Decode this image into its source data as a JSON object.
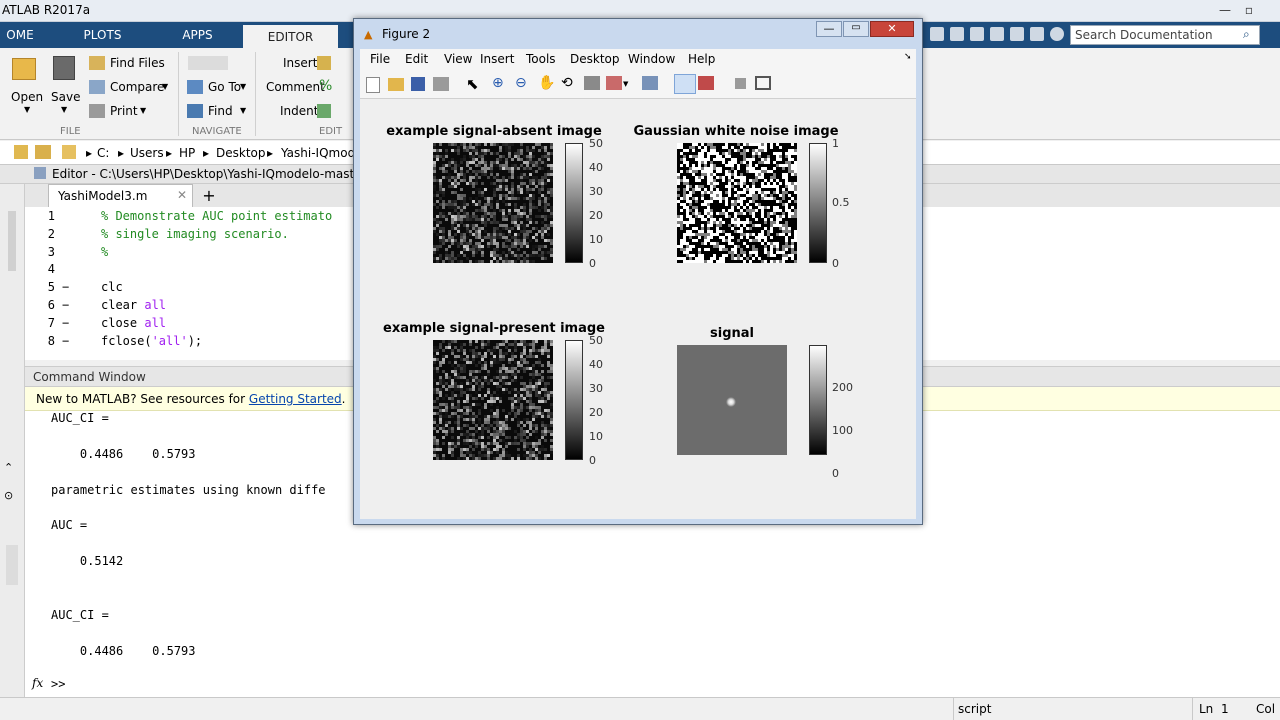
{
  "app": {
    "title": "ATLAB R2017a"
  },
  "tabs": [
    "OME",
    "PLOTS",
    "APPS",
    "EDITOR"
  ],
  "search": {
    "placeholder": "Search Documentation"
  },
  "ribbon": {
    "open": "Open",
    "save": "Save",
    "find_files": "Find Files",
    "compare": "Compare",
    "print": "Print",
    "go_to": "Go To",
    "find": "Find",
    "insert": "Insert",
    "comment": "Comment",
    "indent": "Indent",
    "groups": {
      "file": "FILE",
      "navigate": "NAVIGATE",
      "edit": "EDIT"
    }
  },
  "address": {
    "crumbs": [
      "C:",
      "Users",
      "HP",
      "Desktop",
      "Yashi-IQmode"
    ]
  },
  "editor": {
    "header": "Editor - C:\\Users\\HP\\Desktop\\Yashi-IQmodelo-master\\Ya",
    "tab": "YashiModel3.m",
    "lines": [
      {
        "n": "1",
        "mark": "",
        "text": "% Demonstrate AUC point estimato",
        "kind": "comment"
      },
      {
        "n": "2",
        "mark": "",
        "text": "% single imaging scenario.",
        "kind": "comment"
      },
      {
        "n": "3",
        "mark": "",
        "text": "%",
        "kind": "comment"
      },
      {
        "n": "4",
        "mark": "",
        "text": "",
        "kind": "code"
      },
      {
        "n": "5",
        "mark": "−",
        "text": "clc",
        "kind": "code"
      },
      {
        "n": "6",
        "mark": "−",
        "text": "clear all",
        "kind": "clear"
      },
      {
        "n": "7",
        "mark": "−",
        "text": "close all",
        "kind": "close"
      },
      {
        "n": "8",
        "mark": "−",
        "text": "fclose('all');",
        "kind": "fclose"
      }
    ]
  },
  "command_window": {
    "title": "Command Window",
    "banner_text": "New to MATLAB? See resources for ",
    "banner_link": "Getting Started",
    "banner_end": ".",
    "lines": [
      "AUC_CI =",
      "",
      "    0.4486    0.5793",
      "",
      "parametric estimates using known diffe",
      "",
      "AUC =",
      "",
      "    0.5142",
      "",
      "",
      "AUC_CI =",
      "",
      "    0.4486    0.5793"
    ],
    "prompt": ">>"
  },
  "status": {
    "mode": "script",
    "ln_label": "Ln",
    "ln": "1",
    "col_label": "Col"
  },
  "figure": {
    "title": "Figure 2",
    "menu": [
      "File",
      "Edit",
      "View",
      "Insert",
      "Tools",
      "Desktop",
      "Window",
      "Help"
    ],
    "plots": [
      {
        "title": "example signal-absent image",
        "ticks": [
          "50",
          "40",
          "30",
          "20",
          "10",
          "0"
        ]
      },
      {
        "title": "Gaussian white noise image",
        "ticks": [
          "1",
          "0.5",
          "0"
        ]
      },
      {
        "title": "example signal-present image",
        "ticks": [
          "50",
          "40",
          "30",
          "20",
          "10",
          "0"
        ]
      },
      {
        "title": "signal",
        "ticks": [
          "200",
          "100",
          "0"
        ]
      }
    ]
  },
  "colors": {
    "tabstrip": "#1d4d7e",
    "comment": "#228b22",
    "string": "#a020f0",
    "figure_frame": "#c9d9ee"
  }
}
